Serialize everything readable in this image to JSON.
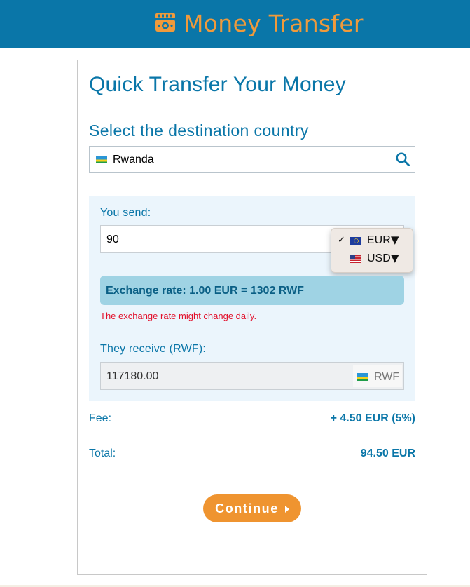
{
  "header": {
    "title": "Money Transfer",
    "icon": "money-icon",
    "background": "#0a76a8",
    "accent": "#ef9a3b"
  },
  "form": {
    "heading": "Quick Transfer Your Money",
    "destination_label": "Select the destination country",
    "destination_value": "Rwanda",
    "destination_flag": "rwanda-flag-icon",
    "send_label": "You send:",
    "send_value": "90",
    "currency_options": [
      {
        "code": "EUR",
        "flag": "eu-flag-icon",
        "selected": true,
        "check": "✓",
        "arrow": "▼"
      },
      {
        "code": "USD",
        "flag": "us-flag-icon",
        "selected": false,
        "check": "",
        "arrow": "▼"
      }
    ],
    "rate_text": "Exchange rate: 1.00 EUR = 1302 RWF",
    "rate_note": "The exchange rate might change daily.",
    "receive_label": "They receive (RWF):",
    "receive_value": "117180.00",
    "receive_currency": "RWF",
    "fee_label": "Fee:",
    "fee_value": "+ 4.50 EUR (5%)",
    "total_label": "Total:",
    "total_value": "94.50 EUR",
    "continue_label": "Continue",
    "continue_color": "#ef9430",
    "warning_color": "#e2102b"
  }
}
